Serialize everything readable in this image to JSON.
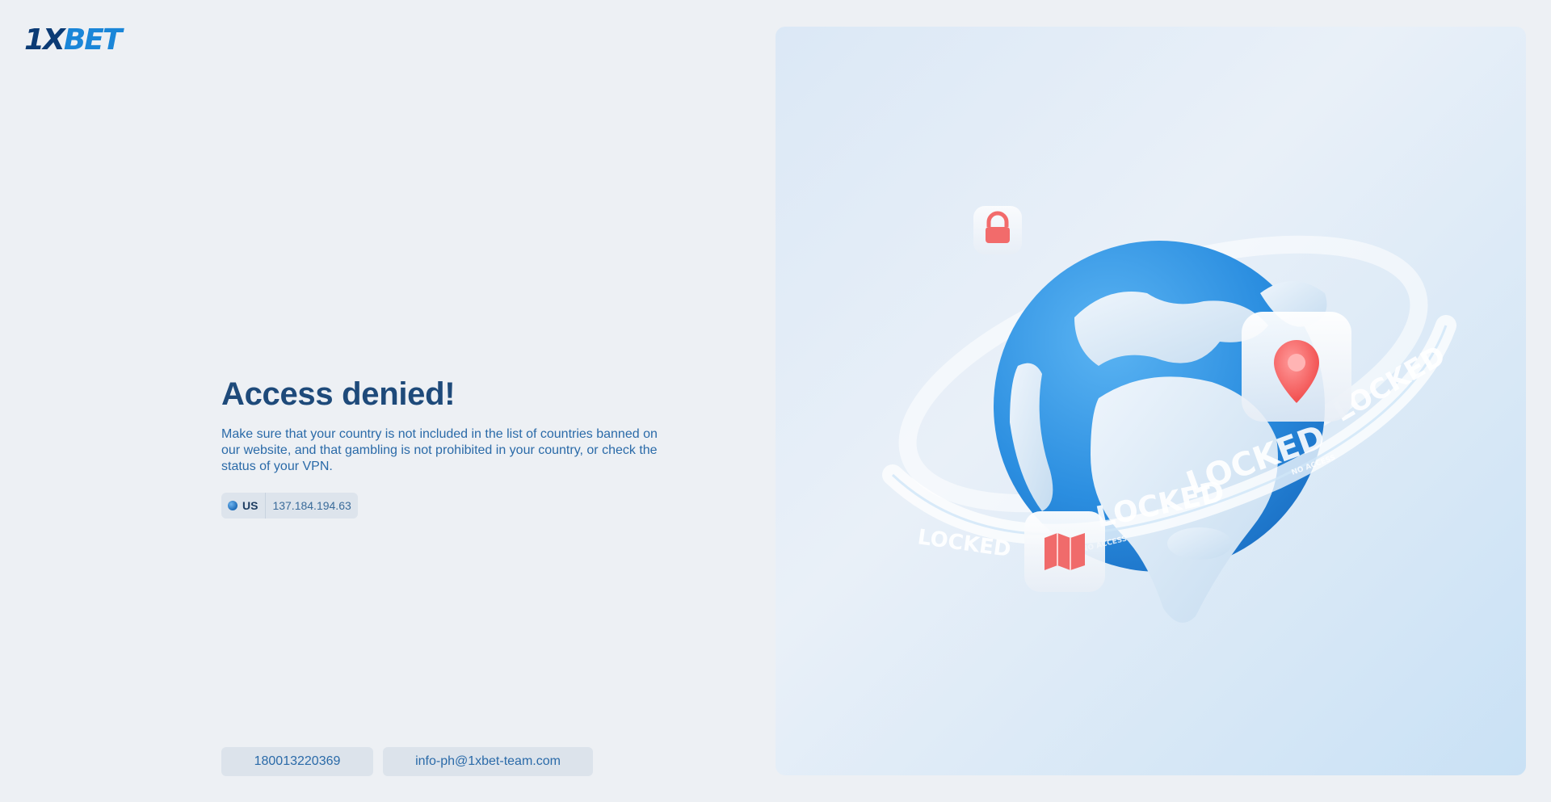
{
  "logo": {
    "part1": "1X",
    "part2": "BET"
  },
  "title": "Access denied!",
  "description": "Make sure that your country is not included in the list of countries banned on our website, and that gambling is not prohibited in your country, or check the status of your VPN.",
  "geo": {
    "country": "US",
    "ip": "137.184.194.63"
  },
  "contacts": {
    "phone": "180013220369",
    "email": "info-ph@1xbet-team.com"
  },
  "illustration": {
    "ring_texts": [
      "LOCKED",
      "NO ACCESS"
    ],
    "icons": [
      "lock-icon",
      "location-pin-icon",
      "map-icon"
    ]
  }
}
